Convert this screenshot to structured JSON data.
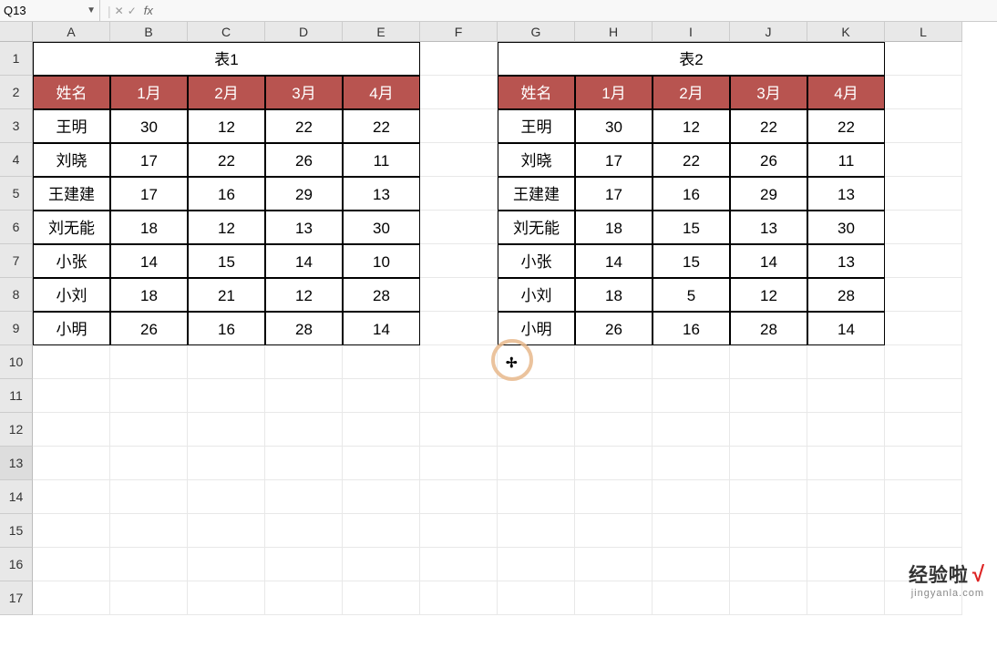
{
  "nameBox": "Q13",
  "formula": "",
  "fxLabel": "fx",
  "cols": [
    "A",
    "B",
    "C",
    "D",
    "E",
    "F",
    "G",
    "H",
    "I",
    "J",
    "K",
    "L"
  ],
  "rowCount": 17,
  "selectedRow": 13,
  "table1": {
    "title": "表1",
    "headers": [
      "姓名",
      "1月",
      "2月",
      "3月",
      "4月"
    ],
    "rows": [
      [
        "王明",
        "30",
        "12",
        "22",
        "22"
      ],
      [
        "刘晓",
        "17",
        "22",
        "26",
        "11"
      ],
      [
        "王建建",
        "17",
        "16",
        "29",
        "13"
      ],
      [
        "刘无能",
        "18",
        "12",
        "13",
        "30"
      ],
      [
        "小张",
        "14",
        "15",
        "14",
        "10"
      ],
      [
        "小刘",
        "18",
        "21",
        "12",
        "28"
      ],
      [
        "小明",
        "26",
        "16",
        "28",
        "14"
      ]
    ]
  },
  "table2": {
    "title": "表2",
    "headers": [
      "姓名",
      "1月",
      "2月",
      "3月",
      "4月"
    ],
    "rows": [
      [
        "王明",
        "30",
        "12",
        "22",
        "22"
      ],
      [
        "刘晓",
        "17",
        "22",
        "26",
        "11"
      ],
      [
        "王建建",
        "17",
        "16",
        "29",
        "13"
      ],
      [
        "刘无能",
        "18",
        "15",
        "13",
        "30"
      ],
      [
        "小张",
        "14",
        "15",
        "14",
        "13"
      ],
      [
        "小刘",
        "18",
        "5",
        "12",
        "28"
      ],
      [
        "小明",
        "26",
        "16",
        "28",
        "14"
      ]
    ]
  },
  "watermark": {
    "line1": "经验啦",
    "check": "√",
    "line2": "jingyanla.com"
  }
}
